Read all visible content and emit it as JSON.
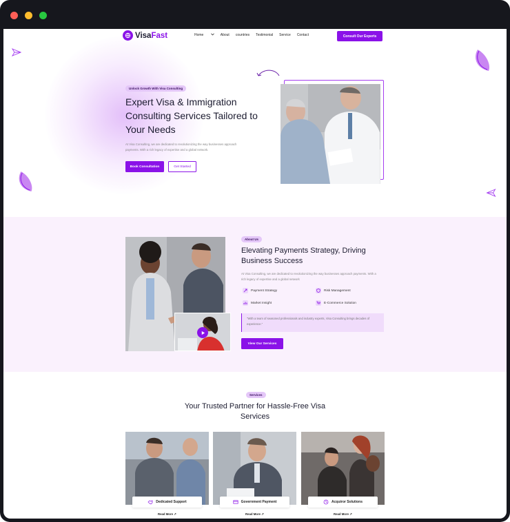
{
  "window": {
    "traffic_lights": [
      "#ff5f57",
      "#febc2e",
      "#28c840"
    ]
  },
  "brand": {
    "name_part1": "Visa",
    "name_part2": "Fast",
    "color": "#8a12e8"
  },
  "nav": {
    "items": [
      "Home",
      "About",
      "countries",
      "Testimonial",
      "Service",
      "Contact"
    ],
    "cta": "Consult Our Experts"
  },
  "hero": {
    "badge": "Unlock Growth With Visa Consulting",
    "title": "Expert Visa & Immigration Consulting Services Tailored to Your Needs",
    "description": "At Visa Consulting, we are dedicated to revolutionizing the way businesses approach payments. With a rich legacy of expertise and a global network.",
    "primary_button": "Book Consultation",
    "secondary_button": "Get Started"
  },
  "about": {
    "badge": "About Us",
    "title": "Elevating Payments Strategy, Driving Business Success",
    "description": "At Visa Consulting, we are dedicated to revolutionizing the way businesses approach payments. With a rich legacy of expertise and a global network",
    "features": [
      "Payment Strategy",
      "Risk Management",
      "Market Insight",
      "E-Commerce Solution"
    ],
    "quote": "\"With a team of seasoned professionals and industry experts, Visa Consulting brings decades of experience.\"",
    "button": "View Our Services"
  },
  "services": {
    "badge": "Services",
    "title": "Your Trusted Partner for Hassle-Free Visa Services",
    "cards": [
      {
        "label": "Dedicated Support",
        "link": "Read More ↗"
      },
      {
        "label": "Government Payment",
        "link": "Read More ↗"
      },
      {
        "label": "Acquiror Solutions",
        "link": "Read More ↗"
      }
    ]
  }
}
